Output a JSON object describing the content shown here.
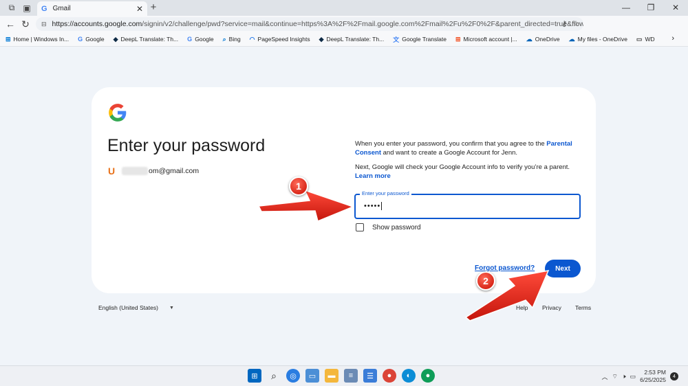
{
  "browser": {
    "tab_title": "Gmail",
    "url_domain": "https://accounts.google.com",
    "url_rest": "/signin/v2/challenge/pwd?service=mail&continue=https%3A%2F%2Fmail.google.com%2Fmail%2Fu%2F0%2F&parent_directed=true&flowName=Glif...",
    "bookmarks": [
      {
        "label": "Home | Windows In...",
        "icon": "windows-icon",
        "color": "#0078d4"
      },
      {
        "label": "Google",
        "icon": "google-icon",
        "color": "#4285f4"
      },
      {
        "label": "DeepL Translate: Th...",
        "icon": "deepl-icon",
        "color": "#0f2b46"
      },
      {
        "label": "Google",
        "icon": "google-icon",
        "color": "#4285f4"
      },
      {
        "label": "Bing",
        "icon": "search-icon",
        "color": "#0078d4"
      },
      {
        "label": "PageSpeed Insights",
        "icon": "pagespeed-icon",
        "color": "#1a73e8"
      },
      {
        "label": "DeepL Translate: Th...",
        "icon": "deepl-icon",
        "color": "#0f2b46"
      },
      {
        "label": "Google Translate",
        "icon": "translate-icon",
        "color": "#4285f4"
      },
      {
        "label": "Microsoft account |...",
        "icon": "microsoft-icon",
        "color": "#f25022"
      },
      {
        "label": "OneDrive",
        "icon": "cloud-icon",
        "color": "#0364b8"
      },
      {
        "label": "My files - OneDrive",
        "icon": "cloud-icon",
        "color": "#0364b8"
      },
      {
        "label": "WD",
        "icon": "folder-icon",
        "color": "#444444"
      }
    ]
  },
  "signin": {
    "title": "Enter your password",
    "email": "om@gmail.com",
    "consent_pre": "When you enter your password, you confirm that you agree to the ",
    "consent_link": "Parental Consent",
    "consent_post": " and want to create a Google Account for Jenn.",
    "check_text": "Next, Google will check your Google Account info to verify you’re a parent.",
    "learn_more": "Learn more",
    "password_label": "Enter your password",
    "password_value": "•••••",
    "show_password": "Show password",
    "forgot_password": "Forgot password?",
    "next": "Next"
  },
  "footer": {
    "language": "English (United States)",
    "help": "Help",
    "privacy": "Privacy",
    "terms": "Terms"
  },
  "annotations": {
    "step1": "1",
    "step2": "2",
    "color": "#e3261b"
  },
  "taskbar": {
    "time": "2:53 PM",
    "date": "6/25/2025",
    "notifications": "4"
  }
}
